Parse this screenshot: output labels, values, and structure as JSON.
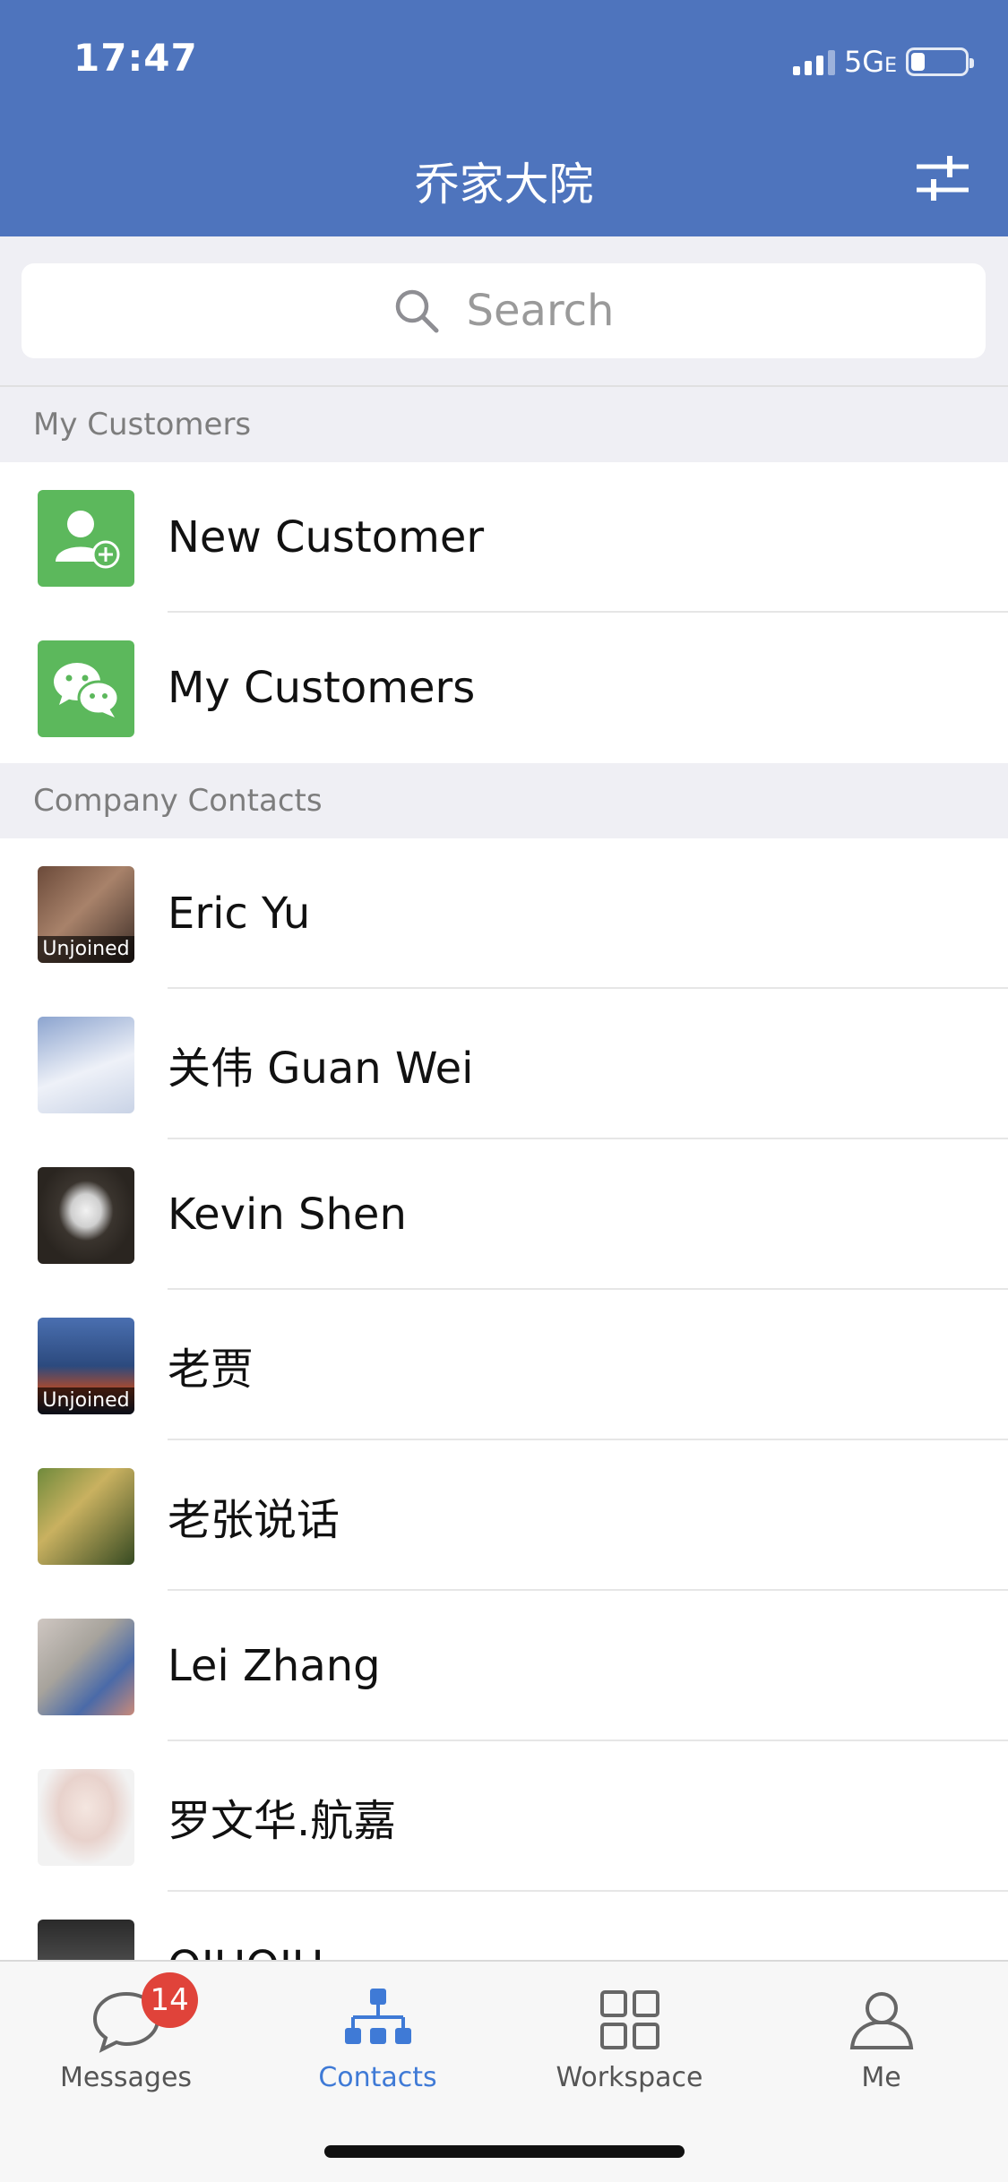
{
  "status_bar": {
    "time": "17:47",
    "network": "5G",
    "network_suffix": "E"
  },
  "nav": {
    "title": "乔家大院",
    "filter_icon": "sliders-icon"
  },
  "search": {
    "placeholder": "Search",
    "icon": "search-icon"
  },
  "sections": {
    "my_customers_header": "My Customers",
    "company_contacts_header": "Company Contacts"
  },
  "customer_rows": [
    {
      "label": "New Customer",
      "icon": "add-person-icon",
      "color": "#5cb85c"
    },
    {
      "label": "My Customers",
      "icon": "wechat-icon",
      "color": "#5cb85c"
    }
  ],
  "contacts": [
    {
      "name": "Eric Yu",
      "status": "Unjoined"
    },
    {
      "name": "关伟 Guan Wei",
      "status": ""
    },
    {
      "name": "Kevin Shen",
      "status": ""
    },
    {
      "name": "老贾",
      "status": "Unjoined"
    },
    {
      "name": "老张说话",
      "status": ""
    },
    {
      "name": "Lei Zhang",
      "status": ""
    },
    {
      "name": "罗文华.航嘉",
      "status": ""
    },
    {
      "name": "QIUQIU",
      "status": ""
    }
  ],
  "tabbar": {
    "tabs": [
      {
        "label": "Messages",
        "icon": "chat-bubble-icon",
        "badge": "14"
      },
      {
        "label": "Contacts",
        "icon": "org-chart-icon",
        "badge": ""
      },
      {
        "label": "Workspace",
        "icon": "grid-icon",
        "badge": ""
      },
      {
        "label": "Me",
        "icon": "person-icon",
        "badge": ""
      }
    ],
    "active_index": 1
  },
  "colors": {
    "header": "#4e74bd",
    "accent": "#3f7ad6",
    "badge": "#e0433a"
  }
}
